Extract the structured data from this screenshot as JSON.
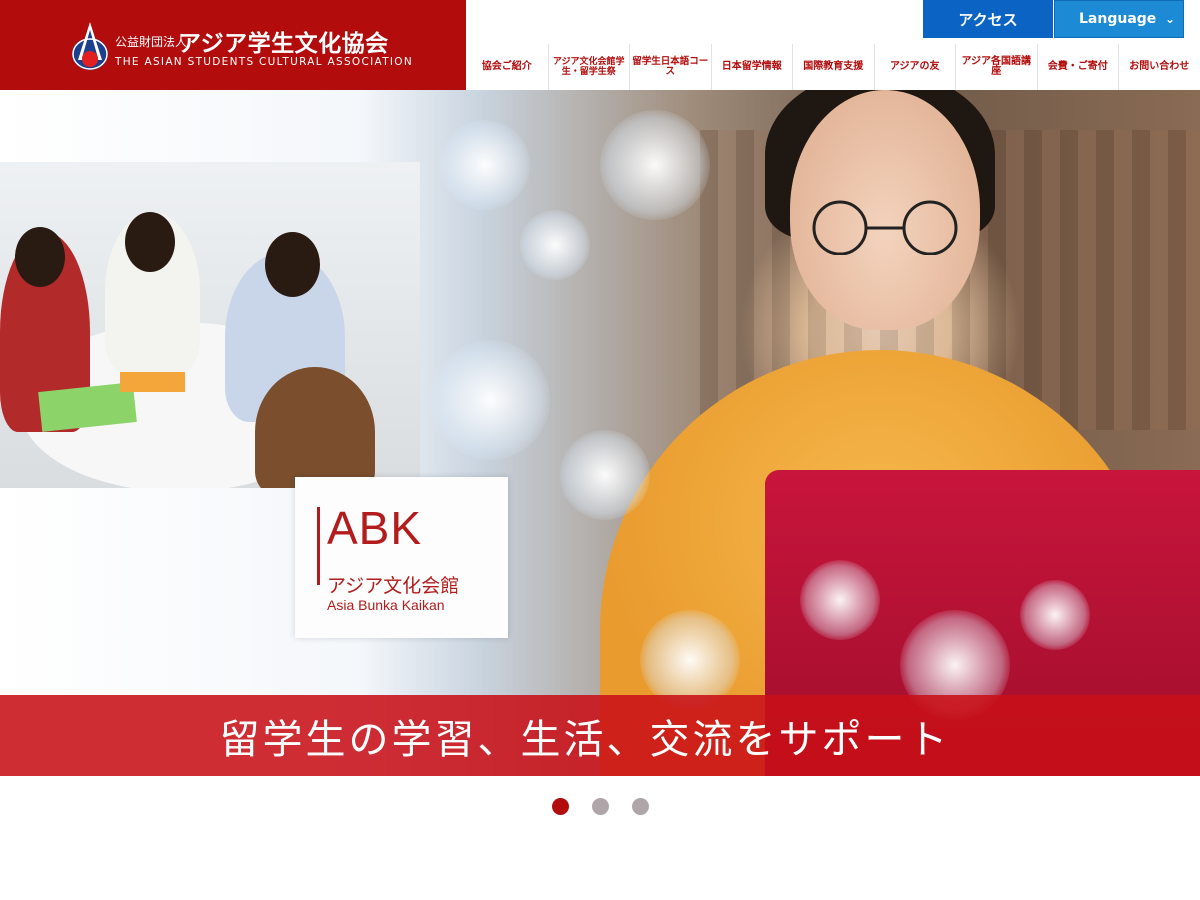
{
  "brand": {
    "org_type": "公益財団法人",
    "org_name": "アジア学生文化協会",
    "org_name_en": "THE ASIAN STUDENTS CULTURAL ASSOCIATION",
    "color": "#b30c0c"
  },
  "topnav": {
    "access_label": "アクセス",
    "language_label": "Language",
    "access_color": "#0b63c4",
    "language_color": "#1d8ad6"
  },
  "menu": {
    "items": [
      {
        "label": "協会ご紹介"
      },
      {
        "label": "アジア文化会館学生・留学生祭"
      },
      {
        "label": "留学生日本語コース"
      },
      {
        "label": "日本留学情報"
      },
      {
        "label": "国際教育支援"
      },
      {
        "label": "アジアの友"
      },
      {
        "label": "アジア各国語講座"
      },
      {
        "label": "会費・ご寄付"
      },
      {
        "label": "お問い合わせ"
      }
    ]
  },
  "hero": {
    "abk_logo": "ABK",
    "abk_name_jp": "アジア文化会館",
    "abk_name_en": "Asia Bunka Kaikan",
    "tagline": "留学生の学習、生活、交流をサポート",
    "band_color": "#c81018"
  },
  "carousel": {
    "slide_count": 3,
    "active_index": 0
  }
}
